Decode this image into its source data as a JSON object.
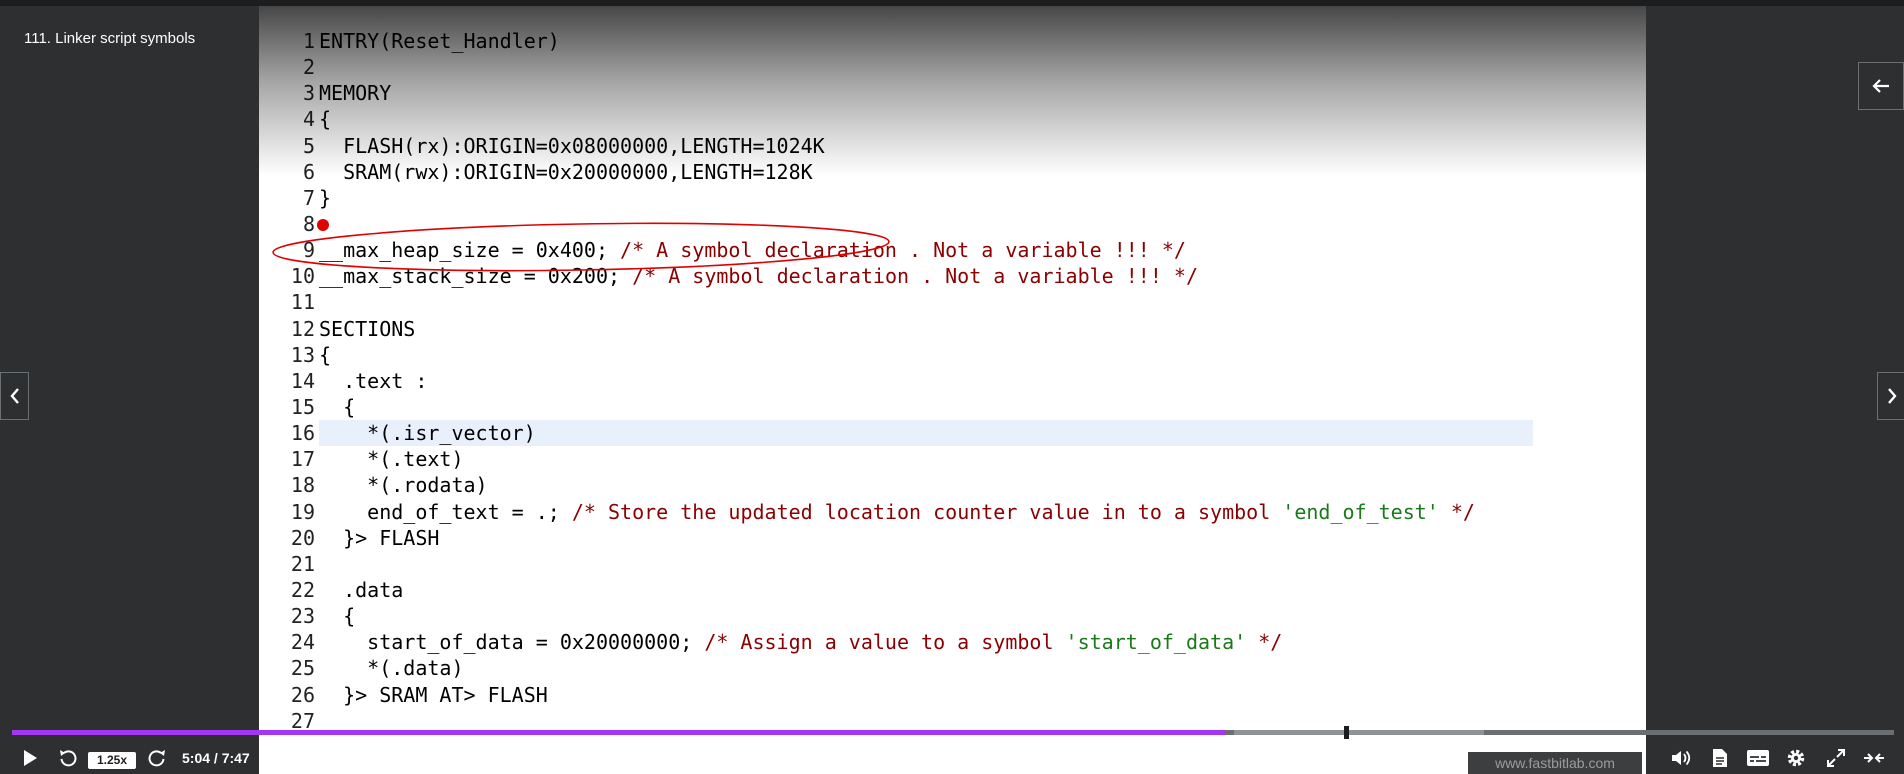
{
  "lecture": {
    "title": "111. Linker script symbols"
  },
  "code_lines": [
    {
      "n": "1",
      "t": "ENTRY(Reset_Handler)"
    },
    {
      "n": "2",
      "t": ""
    },
    {
      "n": "3",
      "t": "MEMORY"
    },
    {
      "n": "4",
      "t": "{"
    },
    {
      "n": "5",
      "t": "  FLASH(rx):ORIGIN=0x08000000,LENGTH=1024K"
    },
    {
      "n": "6",
      "t": "  SRAM(rwx):ORIGIN=0x20000000,LENGTH=128K"
    },
    {
      "n": "7",
      "t": "}"
    },
    {
      "n": "8",
      "t": ""
    },
    {
      "n": "9",
      "t": "__max_heap_size = 0x400; ",
      "c": "/* A symbol declaration . Not a variable !!! */"
    },
    {
      "n": "10",
      "t": "__max_stack_size = 0x200; ",
      "c": "/* A symbol declaration . Not a variable !!! */"
    },
    {
      "n": "11",
      "t": ""
    },
    {
      "n": "12",
      "t": "SECTIONS"
    },
    {
      "n": "13",
      "t": "{"
    },
    {
      "n": "14",
      "t": "  .text :"
    },
    {
      "n": "15",
      "t": "  {"
    },
    {
      "n": "16",
      "t": "    *(.isr_vector)"
    },
    {
      "n": "17",
      "t": "    *(.text)"
    },
    {
      "n": "18",
      "t": "    *(.rodata)"
    },
    {
      "n": "19",
      "t": "    end_of_text = .; ",
      "c": "/* Store the updated location counter value in to a symbol ",
      "s": "'end_of_test'",
      "c2": " */"
    },
    {
      "n": "20",
      "t": "  }> FLASH"
    },
    {
      "n": "21",
      "t": ""
    },
    {
      "n": "22",
      "t": "  .data"
    },
    {
      "n": "23",
      "t": "  {"
    },
    {
      "n": "24",
      "t": "    start_of_data = 0x20000000; ",
      "c": "/* Assign a value to a symbol ",
      "s": "'start_of_data'",
      "c2": " */"
    },
    {
      "n": "25",
      "t": "    *(.data)"
    },
    {
      "n": "26",
      "t": "  }> SRAM AT> FLASH"
    },
    {
      "n": "27",
      "t": ""
    }
  ],
  "watermark": "www.fastbitlab.com",
  "player": {
    "speed": "1.25x",
    "time": "5:04 / 7:47",
    "progress": 0.645
  },
  "colors": {
    "accent": "#a435f0",
    "annotation": "#e00000"
  },
  "icons": {
    "play": "play-icon",
    "rewind": "rewind-5-icon",
    "forward": "forward-5-icon",
    "notes": "add-note-icon",
    "volume": "volume-icon",
    "transcript": "transcript-icon",
    "captions": "captions-icon",
    "settings": "gear-icon",
    "fullscreen": "fullscreen-icon",
    "expand": "expand-icon",
    "back": "arrow-left-icon",
    "prev": "chevron-left-icon",
    "next": "chevron-right-icon"
  }
}
